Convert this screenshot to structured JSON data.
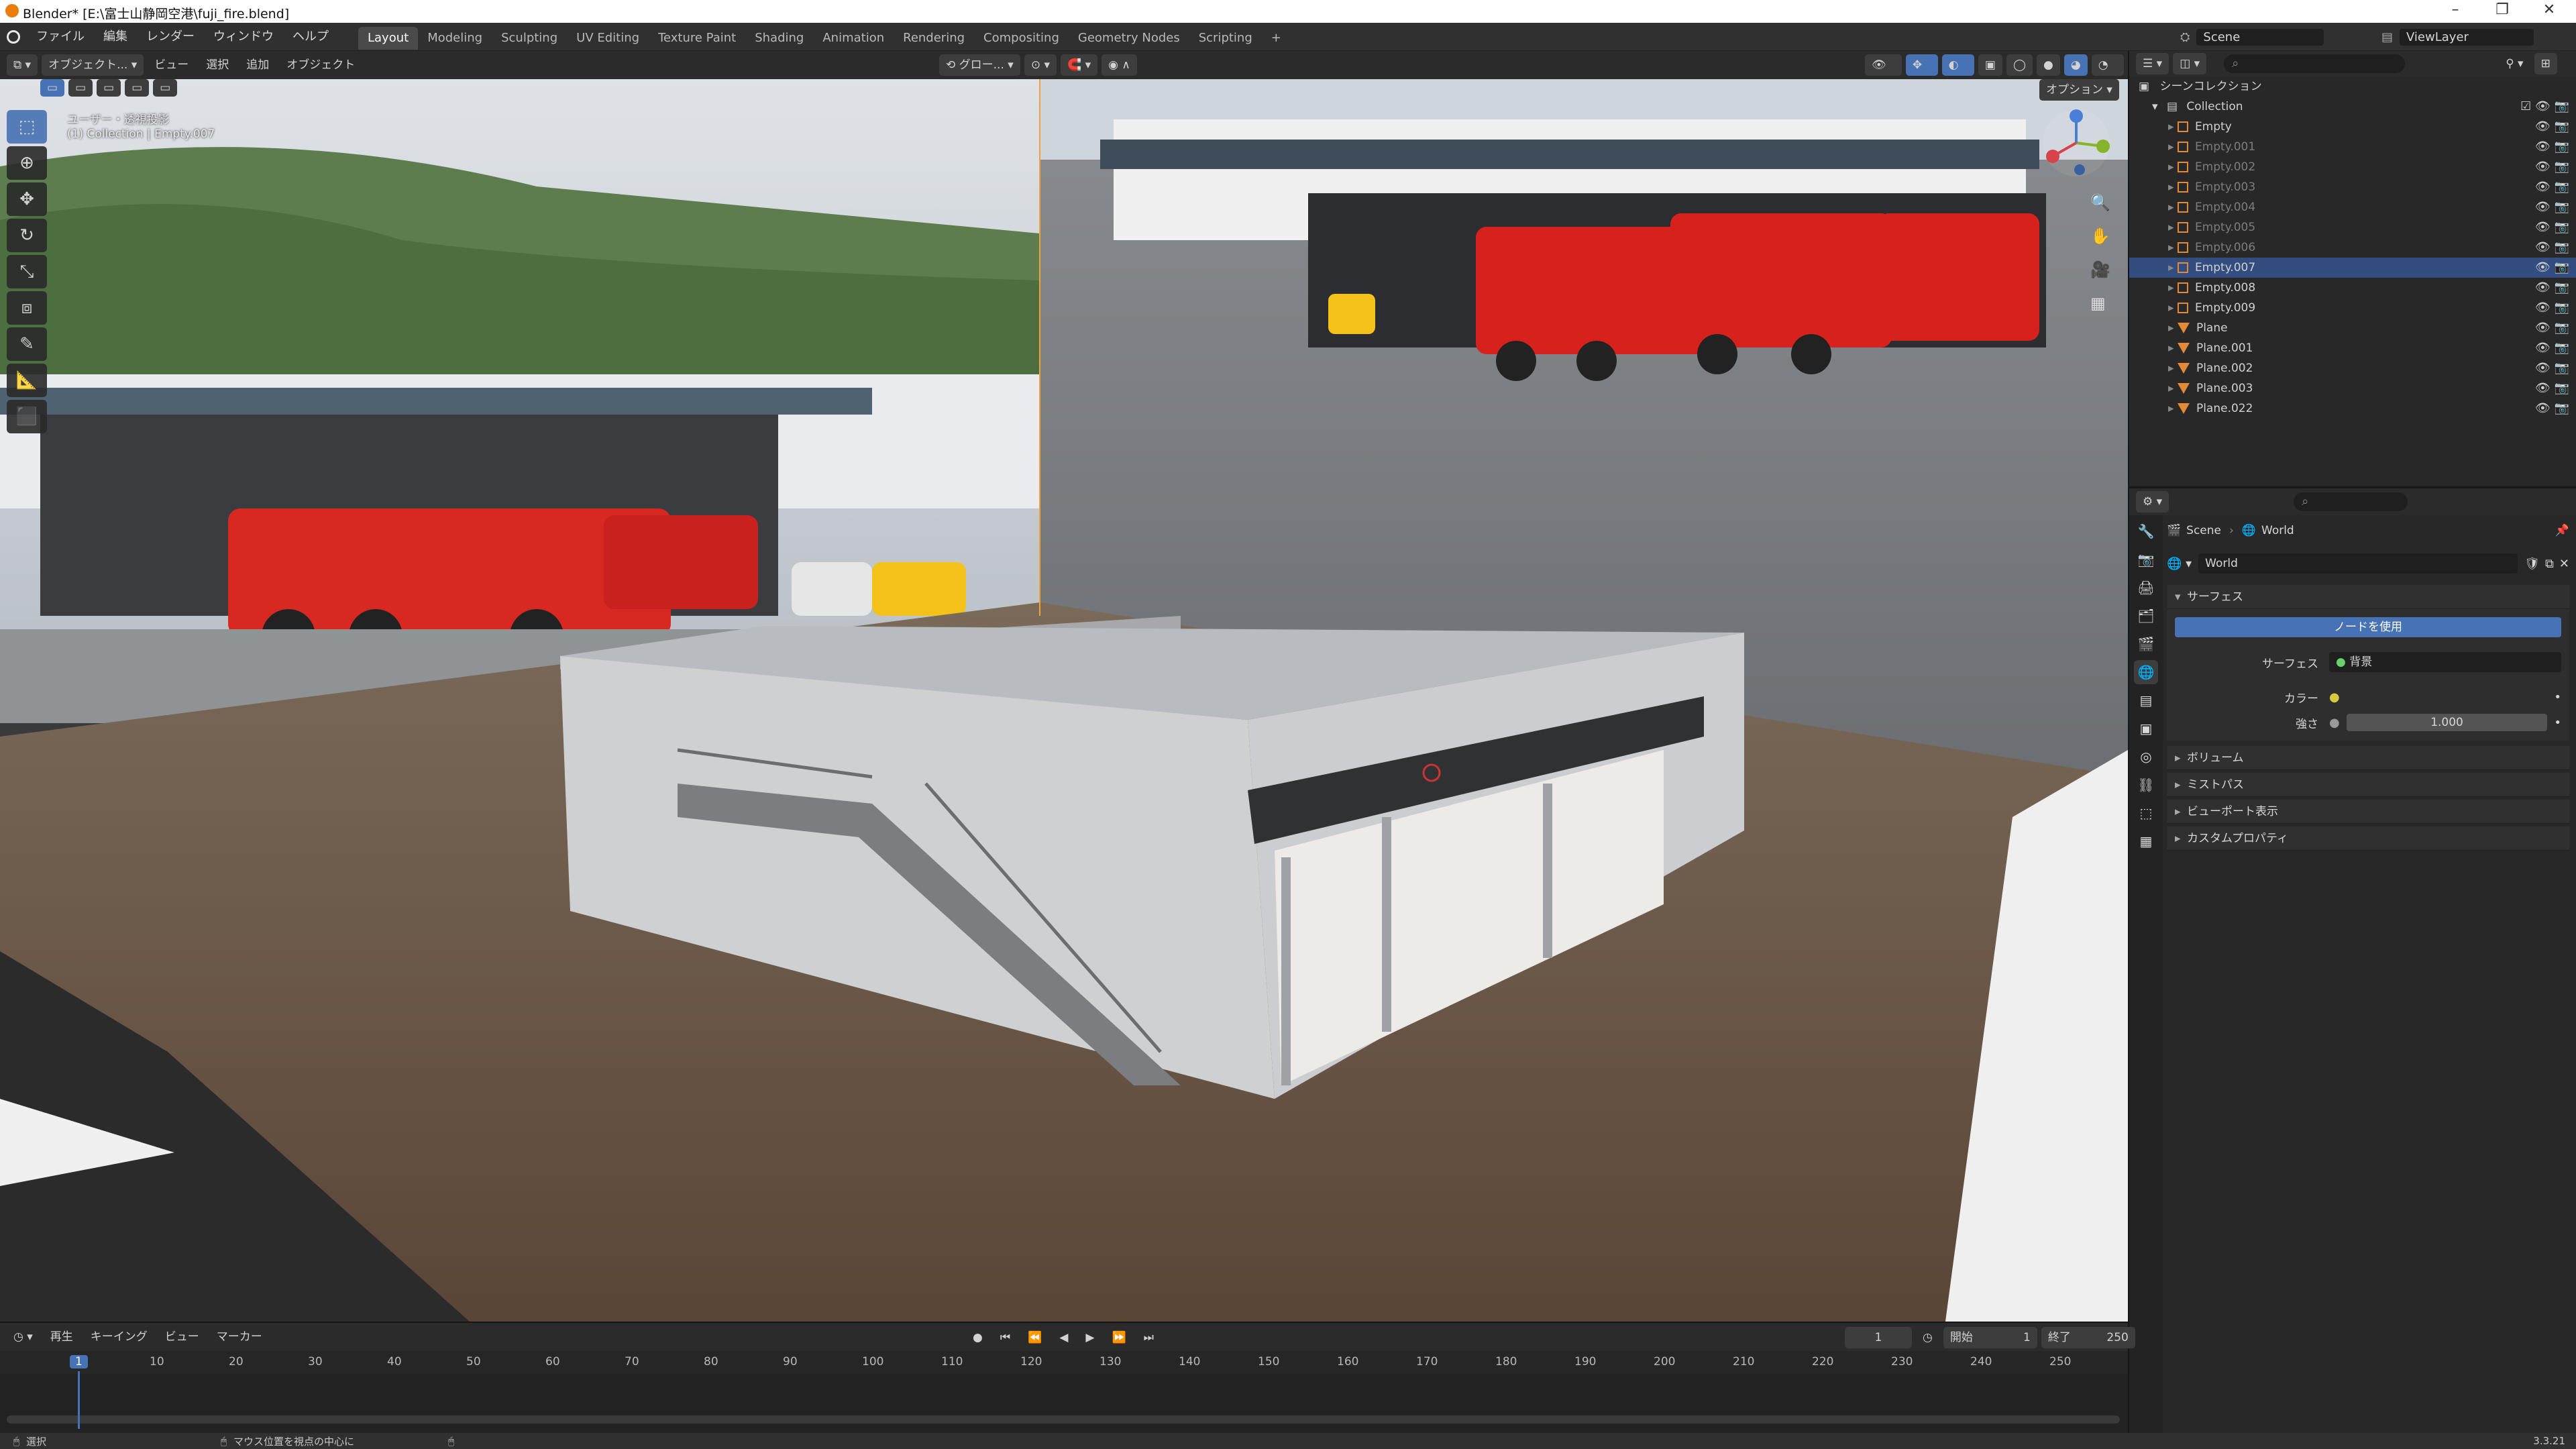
{
  "window": {
    "title": "Blender* [E:\\富士山静岡空港\\fuji_fire.blend]"
  },
  "menu": [
    "ファイル",
    "編集",
    "レンダー",
    "ウィンドウ",
    "ヘルプ"
  ],
  "workspaces": [
    "Layout",
    "Modeling",
    "Sculpting",
    "UV Editing",
    "Texture Paint",
    "Shading",
    "Animation",
    "Rendering",
    "Compositing",
    "Geometry Nodes",
    "Scripting"
  ],
  "active_workspace": "Layout",
  "scene": {
    "name": "Scene",
    "view_layer": "ViewLayer"
  },
  "viewport": {
    "mode": "オブジェクト...",
    "menus": [
      "ビュー",
      "選択",
      "追加",
      "オブジェクト"
    ],
    "transform_orientation": "グロー...",
    "options": "オプション",
    "overlay_title": "ユーザー・透視投影",
    "overlay_subtitle": "(1) Collection | Empty.007"
  },
  "outliner": {
    "root": "シーンコレクション",
    "collection": "Collection",
    "items": [
      {
        "name": "Empty",
        "type": "empty",
        "dim": false,
        "selected": false
      },
      {
        "name": "Empty.001",
        "type": "empty",
        "dim": true,
        "selected": false
      },
      {
        "name": "Empty.002",
        "type": "empty",
        "dim": true,
        "selected": false
      },
      {
        "name": "Empty.003",
        "type": "empty",
        "dim": true,
        "selected": false
      },
      {
        "name": "Empty.004",
        "type": "empty",
        "dim": true,
        "selected": false
      },
      {
        "name": "Empty.005",
        "type": "empty",
        "dim": true,
        "selected": false
      },
      {
        "name": "Empty.006",
        "type": "empty",
        "dim": true,
        "selected": false
      },
      {
        "name": "Empty.007",
        "type": "empty",
        "dim": false,
        "selected": true
      },
      {
        "name": "Empty.008",
        "type": "empty",
        "dim": false,
        "selected": false
      },
      {
        "name": "Empty.009",
        "type": "empty",
        "dim": false,
        "selected": false
      },
      {
        "name": "Plane",
        "type": "mesh",
        "dim": false,
        "selected": false
      },
      {
        "name": "Plane.001",
        "type": "mesh",
        "dim": false,
        "selected": false
      },
      {
        "name": "Plane.002",
        "type": "mesh",
        "dim": false,
        "selected": false
      },
      {
        "name": "Plane.003",
        "type": "mesh",
        "dim": false,
        "selected": false
      },
      {
        "name": "Plane.022",
        "type": "mesh",
        "dim": false,
        "selected": false
      }
    ]
  },
  "properties": {
    "breadcrumb_scene": "Scene",
    "breadcrumb_world": "World",
    "world_name": "World",
    "surface_panel": "サーフェス",
    "use_nodes": "ノードを使用",
    "surface_label": "サーフェス",
    "surface_value": "背景",
    "color_label": "カラー",
    "strength_label": "強さ",
    "strength_value": "1.000",
    "panels": [
      "ボリューム",
      "ミストパス",
      "ビューポート表示",
      "カスタムプロパティ"
    ]
  },
  "timeline": {
    "menus": [
      "再生",
      "キーイング",
      "ビュー",
      "マーカー"
    ],
    "current_frame": "1",
    "start_label": "開始",
    "start": "1",
    "end_label": "終了",
    "end": "250",
    "ticks": [
      "1",
      "10",
      "20",
      "30",
      "40",
      "50",
      "60",
      "70",
      "80",
      "90",
      "100",
      "110",
      "120",
      "130",
      "140",
      "150",
      "160",
      "170",
      "180",
      "190",
      "200",
      "210",
      "220",
      "230",
      "240",
      "250"
    ]
  },
  "status": {
    "select": "選択",
    "center": "マウス位置を視点の中心に",
    "version": "3.3.21"
  }
}
